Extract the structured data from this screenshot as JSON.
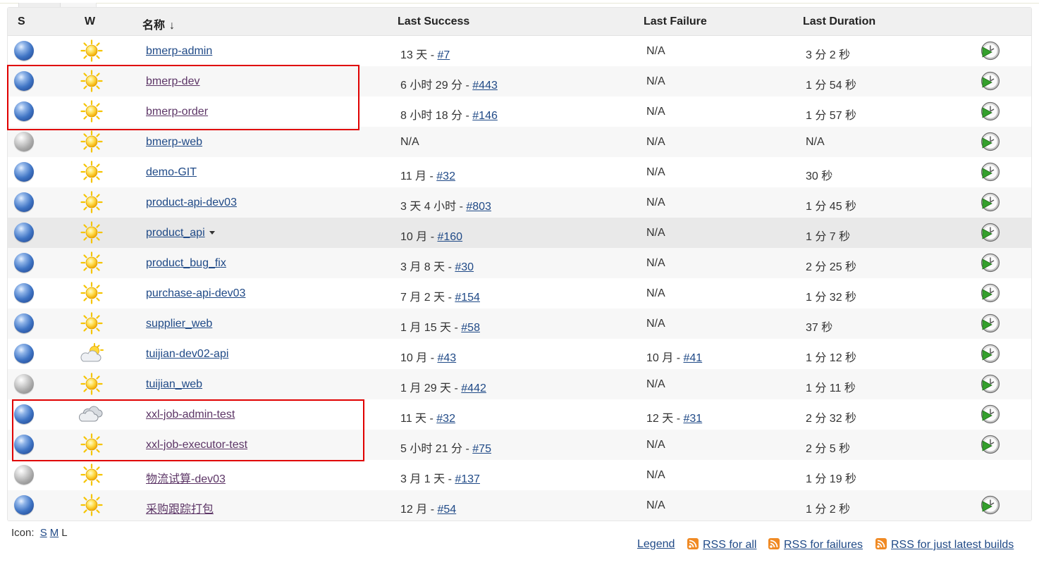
{
  "header": {
    "status": "S",
    "weather": "W",
    "name": "名称",
    "sort_arrow": "↓",
    "last_success": "Last Success",
    "last_failure": "Last Failure",
    "last_duration": "Last Duration"
  },
  "jobs": [
    {
      "status": "blue",
      "weather": "sunny",
      "name": "bmerp-admin",
      "success_time": "13 天 - ",
      "success_build": "#7",
      "failure_time": "N/A",
      "failure_build": "",
      "duration": "3 分 2 秒",
      "schedule": true
    },
    {
      "status": "blue",
      "weather": "sunny",
      "name": "bmerp-dev",
      "success_time": "6 小时 29 分 - ",
      "success_build": "#443",
      "failure_time": "N/A",
      "failure_build": "",
      "duration": "1 分 54 秒",
      "schedule": true
    },
    {
      "status": "blue",
      "weather": "sunny",
      "name": "bmerp-order",
      "success_time": "8 小时 18 分 - ",
      "success_build": "#146",
      "failure_time": "N/A",
      "failure_build": "",
      "duration": "1 分 57 秒",
      "schedule": true
    },
    {
      "status": "grey",
      "weather": "sunny",
      "name": "bmerp-web",
      "success_time": "N/A",
      "success_build": "",
      "failure_time": "N/A",
      "failure_build": "",
      "duration": "N/A",
      "schedule": true
    },
    {
      "status": "blue",
      "weather": "sunny",
      "name": "demo-GIT",
      "success_time": "11 月 - ",
      "success_build": "#32",
      "failure_time": "N/A",
      "failure_build": "",
      "duration": "30 秒",
      "schedule": true
    },
    {
      "status": "blue",
      "weather": "sunny",
      "name": "product-api-dev03",
      "success_time": "3 天 4 小时 - ",
      "success_build": "#803",
      "failure_time": "N/A",
      "failure_build": "",
      "duration": "1 分 45 秒",
      "schedule": true
    },
    {
      "status": "blue",
      "weather": "sunny",
      "name": "product_api",
      "success_time": "10 月 - ",
      "success_build": "#160",
      "failure_time": "N/A",
      "failure_build": "",
      "duration": "1 分 7 秒",
      "schedule": true
    },
    {
      "status": "blue",
      "weather": "sunny",
      "name": "product_bug_fix",
      "success_time": "3 月 8 天 - ",
      "success_build": "#30",
      "failure_time": "N/A",
      "failure_build": "",
      "duration": "2 分 25 秒",
      "schedule": true
    },
    {
      "status": "blue",
      "weather": "sunny",
      "name": "purchase-api-dev03",
      "success_time": "7 月 2 天 - ",
      "success_build": "#154",
      "failure_time": "N/A",
      "failure_build": "",
      "duration": "1 分 32 秒",
      "schedule": true
    },
    {
      "status": "blue",
      "weather": "sunny",
      "name": "supplier_web",
      "success_time": "1 月 15 天 - ",
      "success_build": "#58",
      "failure_time": "N/A",
      "failure_build": "",
      "duration": "37 秒",
      "schedule": true
    },
    {
      "status": "blue",
      "weather": "partly-cloudy",
      "name": "tuijian-dev02-api",
      "success_time": "10 月 - ",
      "success_build": "#43",
      "failure_time": "10 月 - ",
      "failure_build": "#41",
      "duration": "1 分 12 秒",
      "schedule": true
    },
    {
      "status": "grey",
      "weather": "sunny",
      "name": "tuijian_web",
      "success_time": "1 月 29 天 - ",
      "success_build": "#442",
      "failure_time": "N/A",
      "failure_build": "",
      "duration": "1 分 11 秒",
      "schedule": true
    },
    {
      "status": "blue",
      "weather": "cloudy",
      "name": "xxl-job-admin-test",
      "success_time": "11 天 - ",
      "success_build": "#32",
      "failure_time": "12 天 - ",
      "failure_build": "#31",
      "duration": "2 分 32 秒",
      "schedule": true
    },
    {
      "status": "blue",
      "weather": "sunny",
      "name": "xxl-job-executor-test",
      "success_time": "5 小时 21 分 - ",
      "success_build": "#75",
      "failure_time": "N/A",
      "failure_build": "",
      "duration": "2 分 5 秒",
      "schedule": true
    },
    {
      "status": "grey",
      "weather": "sunny",
      "name": "物流试算-dev03",
      "success_time": "3 月 1 天 - ",
      "success_build": "#137",
      "failure_time": "N/A",
      "failure_build": "",
      "duration": "1 分 19 秒",
      "schedule": false
    },
    {
      "status": "blue",
      "weather": "sunny",
      "name": "采购跟踪打包",
      "success_time": "12 月 - ",
      "success_build": "#54",
      "failure_time": "N/A",
      "failure_build": "",
      "duration": "1 分 2 秒",
      "schedule": true
    }
  ],
  "icon_size": {
    "label": "Icon:",
    "small": "S",
    "medium": "M",
    "large": "L"
  },
  "footer": {
    "legend": "Legend",
    "rss_all": "RSS for all",
    "rss_failures": "RSS for failures",
    "rss_latest": "RSS for just latest builds"
  },
  "colors": {
    "link": "#204a87",
    "highlight_box": "#e00000",
    "rss": "#f08a24"
  }
}
